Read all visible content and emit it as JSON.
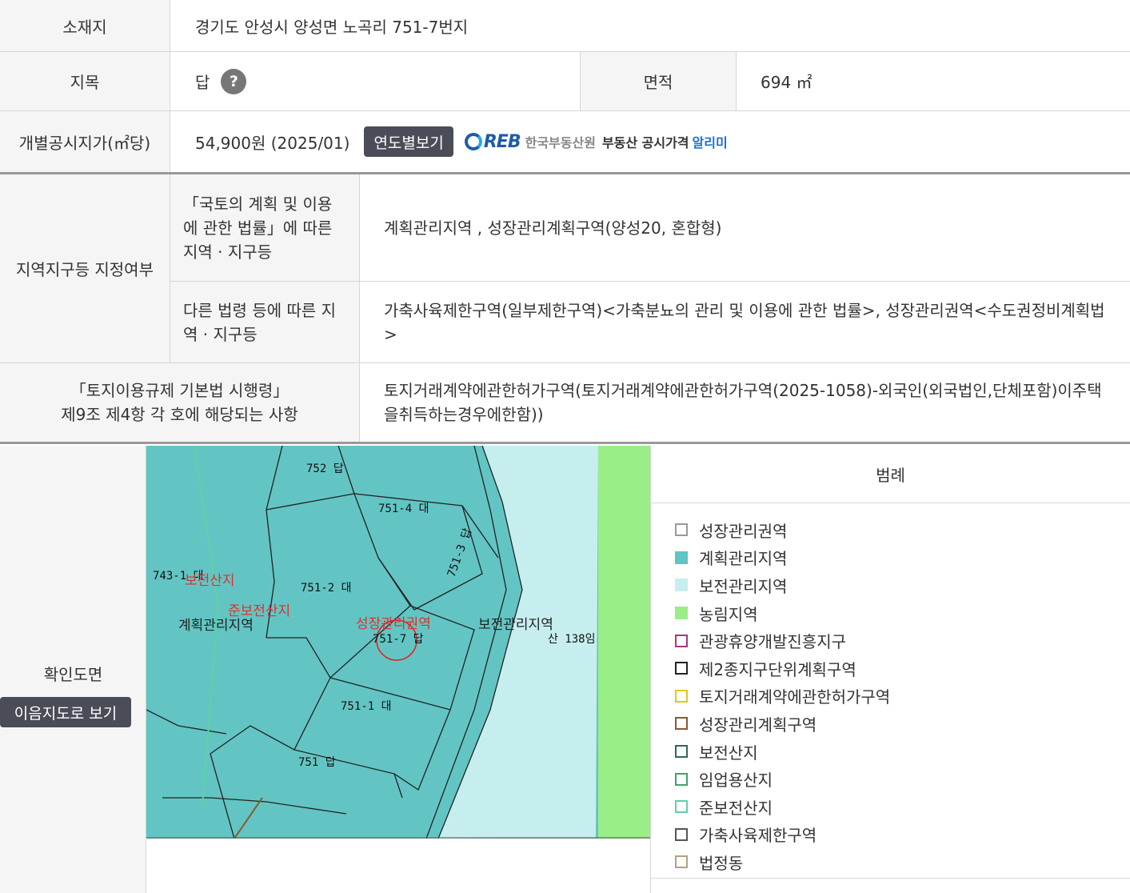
{
  "location": {
    "label": "소재지",
    "value": "경기도 안성시 양성면 노곡리 751-7번지"
  },
  "land_category": {
    "label": "지목",
    "value": "답",
    "help_icon": "?"
  },
  "area": {
    "label": "면적",
    "value": "694 ㎡"
  },
  "official_price": {
    "label": "개별공시지가(㎡당)",
    "value": "54,900원 (2025/01)",
    "button": "연도별보기",
    "reb_logo": "REB",
    "reb_text1": "한국부동산원",
    "reb_text2": "부동산 공시가격",
    "reb_text3": "알리미"
  },
  "zoning": {
    "label": "지역지구등 지정여부",
    "law1_label": "「국토의 계획 및 이용에 관한 법률」에 따른 지역 · 지구등",
    "law1_value": "계획관리지역 , 성장관리계획구역(양성20, 혼합형)",
    "law2_label": "다른 법령 등에 따른 지역 · 지구등",
    "law2_value": "가축사육제한구역(일부제한구역)<가축분뇨의 관리 및 이용에 관한 법률>, 성장관리권역<수도권정비계획법>"
  },
  "regulation": {
    "label_line1": "「토지이용규제 기본법 시행령」",
    "label_line2": "제9조 제4항 각 호에 해당되는 사항",
    "value": "토지거래계약에관한허가구역(토지거래계약에관한허가구역(2025-1058)-외국인(외국법인,단체포함)이주택을취득하는경우에한함))"
  },
  "map_section": {
    "label": "확인도면",
    "button": "이음지도로 보기",
    "parcels": [
      "752 답",
      "751-4 대",
      "751-3 답",
      "743-1 대",
      "751-2 대",
      "751-7 답",
      "751-1 대",
      "751 답",
      "산 138임"
    ],
    "zone_labels": [
      "보전산지",
      "준보전산지",
      "계획관리지역",
      "성장관리권역",
      "보전관리지역"
    ]
  },
  "legend": {
    "title": "범례",
    "items": [
      {
        "label": "성장관리권역",
        "fill": "#ffffff",
        "border": "#999999"
      },
      {
        "label": "계획관리지역",
        "fill": "#5fc4c2",
        "border": "#5fc4c2"
      },
      {
        "label": "보전관리지역",
        "fill": "#c7eeee",
        "border": "#c7eeee"
      },
      {
        "label": "농림지역",
        "fill": "#99ee88",
        "border": "#99ee88"
      },
      {
        "label": "관광휴양개발진흥지구",
        "fill": "#ffffff",
        "border": "#a0388f"
      },
      {
        "label": "제2종지구단위계획구역",
        "fill": "#ffffff",
        "border": "#222222"
      },
      {
        "label": "토지거래계약에관한허가구역",
        "fill": "#ffffff",
        "border": "#e6c619"
      },
      {
        "label": "성장관리계획구역",
        "fill": "#ffffff",
        "border": "#8b5a2b"
      },
      {
        "label": "보전산지",
        "fill": "#ffffff",
        "border": "#2a6b4f"
      },
      {
        "label": "임업용산지",
        "fill": "#ffffff",
        "border": "#3aa56a"
      },
      {
        "label": "준보전산지",
        "fill": "#ffffff",
        "border": "#5fd1a4"
      },
      {
        "label": "가축사육제한구역",
        "fill": "#ffffff",
        "border": "#555555"
      },
      {
        "label": "법정동",
        "fill": "#ffffff",
        "border": "#b5a27a"
      }
    ]
  }
}
